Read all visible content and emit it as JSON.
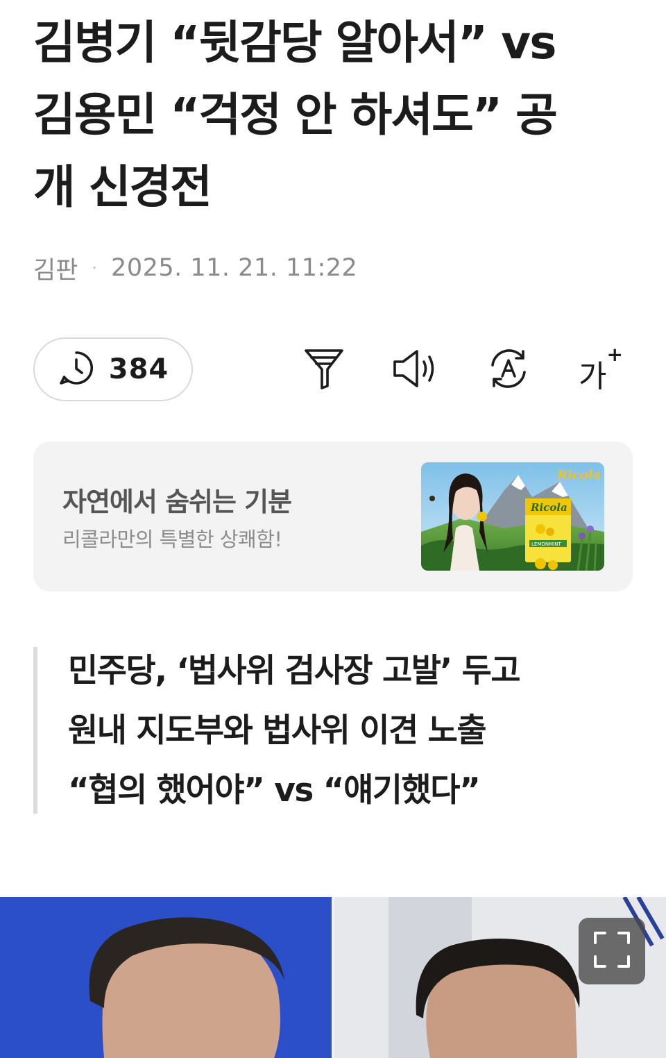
{
  "article": {
    "headline_lines": [
      "김병기 “뒷감당 알아서” vs",
      "김용민 “걱정 안 하셔도” 공",
      "개 신경전"
    ],
    "byline": {
      "reporter": "김판",
      "separator": "·",
      "date": "2025. 11. 21. 11:22"
    },
    "subheadline_lines": [
      "민주당, ‘법사위 검사장 고발’ 두고",
      "원내 지도부와 법사위 이견 노출",
      "“협의 했어야” vs “얘기했다”"
    ]
  },
  "toolbar": {
    "views_count": "384",
    "views_icon": "clock-icon",
    "summary_icon": "filter-icon",
    "tts_icon": "speaker-icon",
    "translate_icon": "translate-icon",
    "font_size_label": "가",
    "font_size_plus": "+"
  },
  "ad": {
    "title": "자연에서 숨쉬는 기분",
    "subtitle": "리콜라만의 특별한 상쾌함!",
    "brand": "Ricola",
    "pack_label": "LEMONMINT"
  },
  "photo": {
    "expand_icon": "expand-icon"
  },
  "colors": {
    "text_primary": "#1c1c1c",
    "text_muted": "#8a8a8a",
    "ad_background": "#f3f3f3",
    "photo_left_bg": "#2a4fc9",
    "photo_right_bg": "#e6e8ec"
  }
}
